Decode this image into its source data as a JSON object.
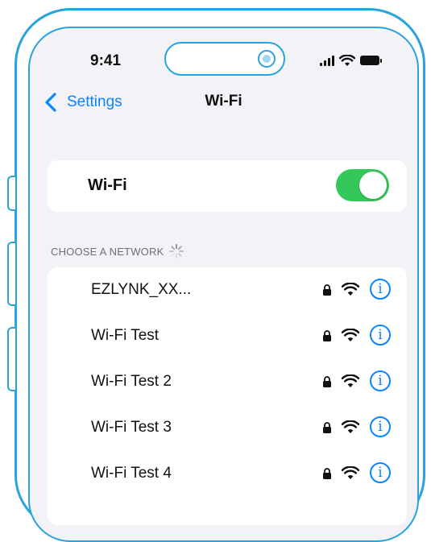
{
  "status_bar": {
    "time": "9:41",
    "icons": [
      "cellular-signal-icon",
      "wifi-icon",
      "battery-icon"
    ]
  },
  "nav": {
    "back_label": "Settings",
    "title": "Wi-Fi"
  },
  "wifi_toggle": {
    "label": "Wi-Fi",
    "on": true
  },
  "networks_section": {
    "header": "CHOOSE A NETWORK",
    "items": [
      {
        "name": "EZLYNK_XX...",
        "secured": true
      },
      {
        "name": "Wi-Fi Test",
        "secured": true
      },
      {
        "name": "Wi-Fi Test 2",
        "secured": true
      },
      {
        "name": "Wi-Fi Test 3",
        "secured": true
      },
      {
        "name": "Wi-Fi Test 4",
        "secured": true
      }
    ]
  },
  "colors": {
    "frame": "#2aa3dd",
    "accent": "#0a84ff",
    "toggle_on": "#34c759",
    "background": "#f2f2f7"
  }
}
